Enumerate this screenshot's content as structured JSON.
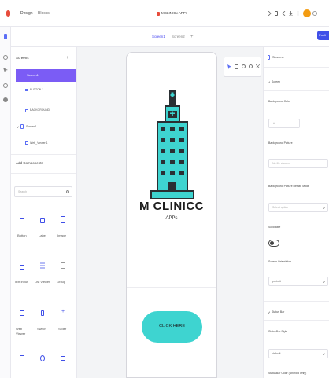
{
  "header": {
    "tab_design": "Design",
    "tab_blocks": "Blocks",
    "project_title": "MCLINICx APPs",
    "publish_label": "Publi"
  },
  "screen_tabs": {
    "screen1": "Screen1",
    "screen2": "Screen2",
    "add": "+"
  },
  "left_panel": {
    "screens_heading": "Screens",
    "add_symbol": "+",
    "tree": [
      {
        "label": "Screen1",
        "selected": true
      },
      {
        "label": "BUTTON 1"
      },
      {
        "label": "BACKGROUND"
      },
      {
        "label": "Screen2"
      },
      {
        "label": "Web_Viewer 1"
      }
    ],
    "add_components_heading": "Add Components",
    "search_placeholder": "Search",
    "components": [
      "Button",
      "Label",
      "Image",
      "Text Input",
      "List Viewer",
      "Group",
      "Web Viewer",
      "Switch",
      "Slider"
    ]
  },
  "canvas": {
    "brand_title": "M CLINICC",
    "brand_subtitle": "APPs",
    "cta_label": "CLICK HERE"
  },
  "right_panel": {
    "screen_name": "Screen1",
    "section_screen": "Screen",
    "bg_color_label": "Background Color",
    "bg_color_value": "#",
    "bg_picture_label": "Background Picture",
    "bg_picture_value": "No file chosen",
    "bg_resize_label": "Background Picture Resize Mode",
    "bg_resize_value": "Select option",
    "scrollable_label": "Scrollable",
    "orientation_label": "Screen Orientation",
    "orientation_value": "portrait",
    "section_status_bar": "Status Bar",
    "statusbar_style_label": "StatusBar Style",
    "statusbar_style_value": "default",
    "statusbar_color_label": "StatusBar Color (Android Only)"
  },
  "colors": {
    "accent": "#7b5cf5",
    "brand_teal": "#3ed4d0",
    "publish_bg": "#3f4fe8",
    "avatar_orange": "#f39c12",
    "logo_red": "#e74c3c"
  }
}
